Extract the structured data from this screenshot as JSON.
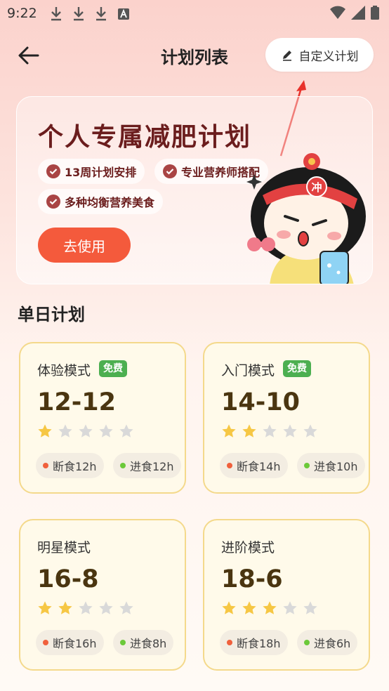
{
  "status_bar": {
    "time": "9:22"
  },
  "header": {
    "title": "计划列表",
    "custom_plan_label": "自定义计划"
  },
  "banner": {
    "title": "个人专属减肥计划",
    "features": [
      "13周计划安排",
      "专业营养师搭配",
      "多种均衡营养美食"
    ],
    "use_button": "去使用",
    "mascot_text": "冲"
  },
  "section": {
    "title": "单日计划"
  },
  "plans": [
    {
      "name": "体验模式",
      "badge": "免费",
      "ratio": "12-12",
      "stars": 1,
      "fast_label": "断食12h",
      "eat_label": "进食12h"
    },
    {
      "name": "入门模式",
      "badge": "免费",
      "ratio": "14-10",
      "stars": 2,
      "fast_label": "断食14h",
      "eat_label": "进食10h"
    },
    {
      "name": "明星模式",
      "badge": "",
      "ratio": "16-8",
      "stars": 2,
      "fast_label": "断食16h",
      "eat_label": "进食8h"
    },
    {
      "name": "进阶模式",
      "badge": "",
      "ratio": "18-6",
      "stars": 3,
      "fast_label": "断食18h",
      "eat_label": "进食6h"
    }
  ],
  "colors": {
    "accent": "#f45a3c",
    "star_on": "#f6c744",
    "star_off": "#d9d9d9",
    "fast_dot": "#f0603c",
    "eat_dot": "#6cc93a",
    "badge": "#4caf50"
  }
}
